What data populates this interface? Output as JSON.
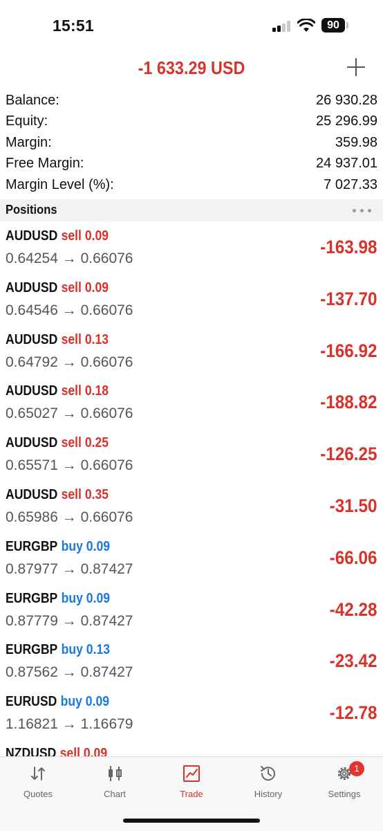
{
  "status_bar": {
    "time": "15:51",
    "battery": "90"
  },
  "header": {
    "total_pl": "-1 633.29 USD"
  },
  "account": [
    {
      "label": "Balance:",
      "value": "26 930.28"
    },
    {
      "label": "Equity:",
      "value": "25 296.99"
    },
    {
      "label": "Margin:",
      "value": "359.98"
    },
    {
      "label": "Free Margin:",
      "value": "24 937.01"
    },
    {
      "label": "Margin Level (%):",
      "value": "7 027.33"
    }
  ],
  "positions_section": {
    "title": "Positions"
  },
  "positions": [
    {
      "symbol": "AUDUSD",
      "side": "sell",
      "volume": "0.09",
      "prices": "0.64254 → 0.66076",
      "profit": "-163.98"
    },
    {
      "symbol": "AUDUSD",
      "side": "sell",
      "volume": "0.09",
      "prices": "0.64546 → 0.66076",
      "profit": "-137.70"
    },
    {
      "symbol": "AUDUSD",
      "side": "sell",
      "volume": "0.13",
      "prices": "0.64792 → 0.66076",
      "profit": "-166.92"
    },
    {
      "symbol": "AUDUSD",
      "side": "sell",
      "volume": "0.18",
      "prices": "0.65027 → 0.66076",
      "profit": "-188.82"
    },
    {
      "symbol": "AUDUSD",
      "side": "sell",
      "volume": "0.25",
      "prices": "0.65571 → 0.66076",
      "profit": "-126.25"
    },
    {
      "symbol": "AUDUSD",
      "side": "sell",
      "volume": "0.35",
      "prices": "0.65986 → 0.66076",
      "profit": "-31.50"
    },
    {
      "symbol": "EURGBP",
      "side": "buy",
      "volume": "0.09",
      "prices": "0.87977 → 0.87427",
      "profit": "-66.06"
    },
    {
      "symbol": "EURGBP",
      "side": "buy",
      "volume": "0.09",
      "prices": "0.87779 → 0.87427",
      "profit": "-42.28"
    },
    {
      "symbol": "EURGBP",
      "side": "buy",
      "volume": "0.13",
      "prices": "0.87562 → 0.87427",
      "profit": "-23.42"
    },
    {
      "symbol": "EURUSD",
      "side": "buy",
      "volume": "0.09",
      "prices": "1.16821 → 1.16679",
      "profit": "-12.78"
    },
    {
      "symbol": "NZDUSD",
      "side": "sell",
      "volume": "0.09",
      "prices": "",
      "profit": ""
    }
  ],
  "tabs": [
    {
      "label": "Quotes",
      "icon": "quotes-icon"
    },
    {
      "label": "Chart",
      "icon": "chart-icon"
    },
    {
      "label": "Trade",
      "icon": "trade-icon",
      "active": true
    },
    {
      "label": "History",
      "icon": "history-icon"
    },
    {
      "label": "Settings",
      "icon": "settings-icon",
      "badge": "1"
    }
  ],
  "colors": {
    "loss": "#d9322a",
    "buy": "#1a7ae0",
    "sell": "#d9322a",
    "active_tab": "#d9322a"
  }
}
